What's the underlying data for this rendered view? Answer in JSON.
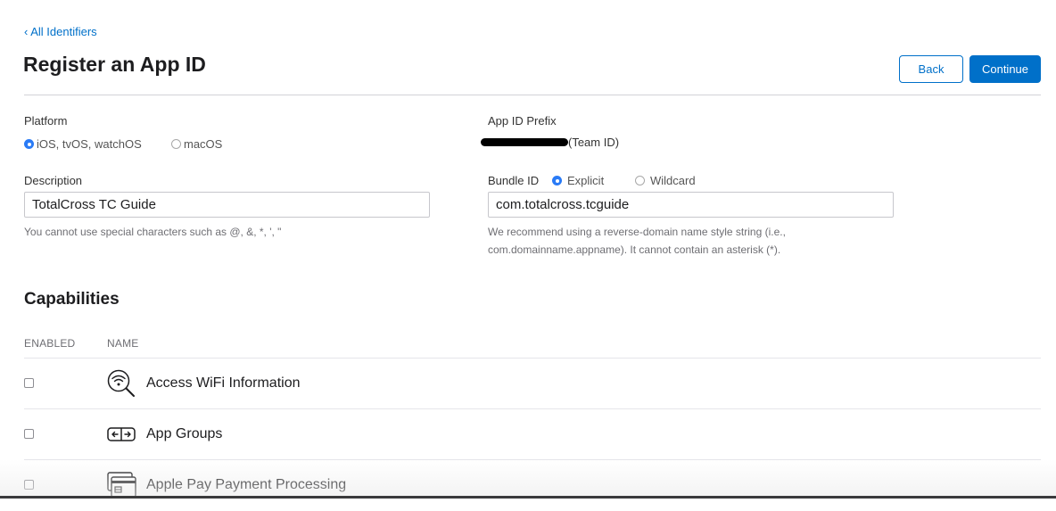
{
  "nav": {
    "back_link": "‹ All Identifiers"
  },
  "header": {
    "title": "Register an App ID",
    "back_button": "Back",
    "continue_button": "Continue"
  },
  "platform": {
    "label": "Platform",
    "options": [
      {
        "label": "iOS, tvOS, watchOS",
        "selected": true
      },
      {
        "label": "macOS",
        "selected": false
      }
    ]
  },
  "prefix": {
    "label": "App ID Prefix",
    "team_suffix": "(Team ID)"
  },
  "description": {
    "label": "Description",
    "value": "TotalCross TC Guide",
    "hint": "You cannot use special characters such as @, &, *, ', \""
  },
  "bundle": {
    "label": "Bundle ID",
    "options": [
      {
        "label": "Explicit",
        "selected": true
      },
      {
        "label": "Wildcard",
        "selected": false
      }
    ],
    "value": "com.totalcross.tcguide",
    "hint_line1": "We recommend using a reverse-domain name style string (i.e.,",
    "hint_line2": "com.domainname.appname). It cannot contain an asterisk (*)."
  },
  "capabilities": {
    "title": "Capabilities",
    "col_enabled": "ENABLED",
    "col_name": "NAME",
    "rows": [
      {
        "name": "Access WiFi Information",
        "icon": "wifi-search-icon",
        "enabled": false
      },
      {
        "name": "App Groups",
        "icon": "app-groups-icon",
        "enabled": false
      },
      {
        "name": "Apple Pay Payment Processing",
        "icon": "apple-pay-card-icon",
        "enabled": false
      }
    ]
  },
  "colors": {
    "accent": "#0070c9",
    "radio_on": "#2a7bf6",
    "divider": "#d2d2d7"
  }
}
